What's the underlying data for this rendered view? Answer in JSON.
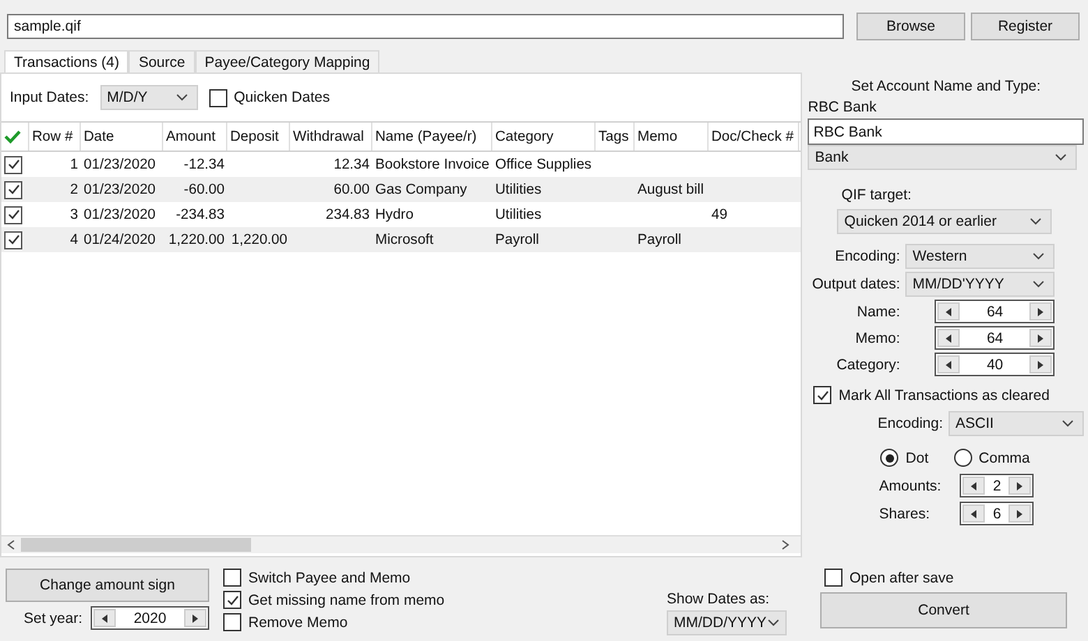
{
  "file_path": {
    "value": "sample.qif"
  },
  "header_buttons": [
    "Browse",
    "Register"
  ],
  "tabs": [
    {
      "label": "Transactions (4)",
      "selected": true
    },
    {
      "label": "Source",
      "selected": false
    },
    {
      "label": "Payee/Category Mapping",
      "selected": false
    }
  ],
  "input_dates": {
    "label": "Input Dates:",
    "value": "M/D/Y"
  },
  "quicken_dates": {
    "label": "Quicken Dates",
    "checked": false
  },
  "table": {
    "columns": [
      "Row #",
      "Date",
      "Amount",
      "Deposit",
      "Withdrawal",
      "Name (Payee/r)",
      "Category",
      "Tags",
      "Memo",
      "Doc/Check #"
    ],
    "rows": [
      {
        "checked": true,
        "cells": [
          "1",
          "01/23/2020",
          "-12.34",
          "",
          "12.34",
          "Bookstore Invoice",
          "Office Supplies",
          "",
          "",
          ""
        ]
      },
      {
        "checked": true,
        "cells": [
          "2",
          "01/23/2020",
          "-60.00",
          "",
          "60.00",
          "Gas Company",
          "Utilities",
          "",
          "August bill",
          ""
        ]
      },
      {
        "checked": true,
        "cells": [
          "3",
          "01/23/2020",
          "-234.83",
          "",
          "234.83",
          "Hydro",
          "Utilities",
          "",
          "",
          "49"
        ]
      },
      {
        "checked": true,
        "cells": [
          "4",
          "01/24/2020",
          "1,220.00",
          "1,220.00",
          "",
          "Microsoft",
          "Payroll",
          "",
          "Payroll",
          ""
        ]
      }
    ]
  },
  "account": {
    "title": "Set Account Name and Type:",
    "label": "RBC Bank",
    "name": "RBC Bank",
    "type": "Bank"
  },
  "qif_target": {
    "label": "QIF target:",
    "value": "Quicken 2014 or earlier"
  },
  "settings": [
    {
      "kind": "dropdown",
      "label": "Encoding:",
      "value": "Western"
    },
    {
      "kind": "dropdown",
      "label": "Output dates:",
      "value": "MM/DD'YYYY"
    },
    {
      "kind": "spinner",
      "label": "Name:",
      "value": "64"
    },
    {
      "kind": "spinner",
      "label": "Memo:",
      "value": "64"
    },
    {
      "kind": "spinner",
      "label": "Category:",
      "value": "40"
    }
  ],
  "mark_cleared": {
    "label": "Mark All Transactions as cleared",
    "checked": true
  },
  "output_encoding": {
    "label": "Encoding:",
    "value": "ASCII"
  },
  "decimal": [
    {
      "label": "Dot",
      "selected": true
    },
    {
      "label": "Comma",
      "selected": false
    }
  ],
  "precision": [
    {
      "label": "Amounts:",
      "value": "2"
    },
    {
      "label": "Shares:",
      "value": "6"
    }
  ],
  "change_sign_button": "Change amount sign",
  "set_year": {
    "label": "Set year:",
    "value": "2020"
  },
  "options": [
    {
      "label": "Switch Payee and Memo",
      "checked": false
    },
    {
      "label": "Get missing name from memo",
      "checked": true
    },
    {
      "label": "Remove Memo",
      "checked": false
    }
  ],
  "show_dates": {
    "label": "Show Dates as:",
    "value": "MM/DD/YYYY"
  },
  "open_after_save": {
    "label": "Open after save",
    "checked": false
  },
  "convert_button": "Convert"
}
